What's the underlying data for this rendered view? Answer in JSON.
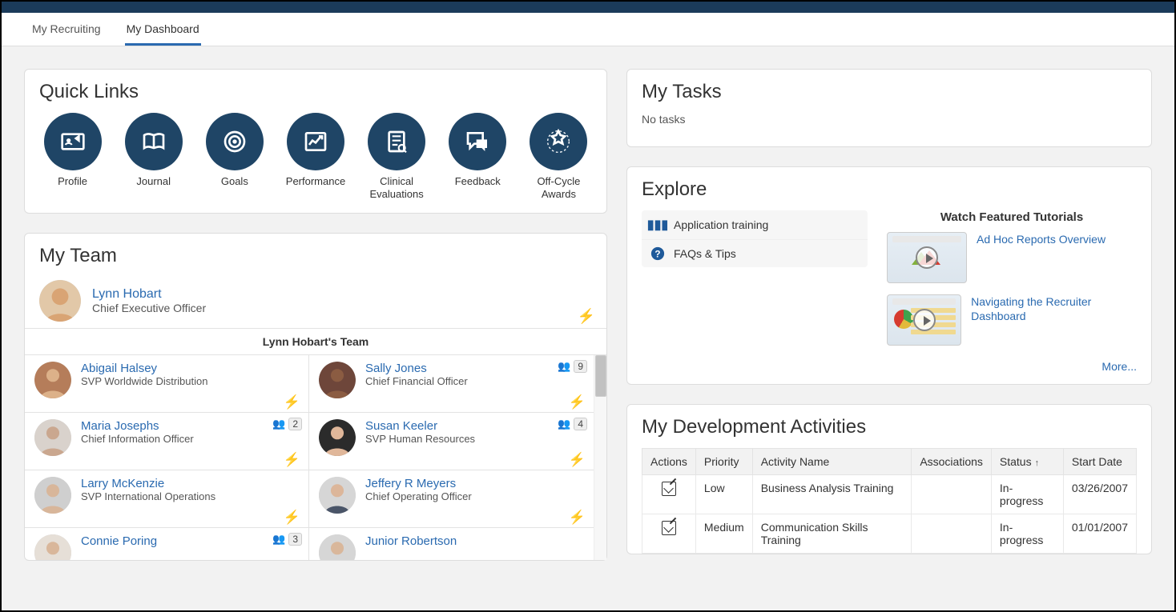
{
  "tabs": [
    {
      "label": "My Recruiting",
      "active": false
    },
    {
      "label": "My Dashboard",
      "active": true
    }
  ],
  "quickLinks": {
    "title": "Quick Links",
    "items": [
      {
        "label": "Profile"
      },
      {
        "label": "Journal"
      },
      {
        "label": "Goals"
      },
      {
        "label": "Performance"
      },
      {
        "label": "Clinical Evaluations"
      },
      {
        "label": "Feedback"
      },
      {
        "label": "Off-Cycle Awards"
      }
    ]
  },
  "myTeam": {
    "title": "My Team",
    "manager": {
      "name": "Lynn Hobart",
      "title": "Chief Executive Officer"
    },
    "teamLabel": "Lynn Hobart's Team",
    "members": [
      {
        "name": "Abigail Halsey",
        "title": "SVP Worldwide Distribution",
        "count": null
      },
      {
        "name": "Sally Jones",
        "title": "Chief Financial Officer",
        "count": "9"
      },
      {
        "name": "Maria Josephs",
        "title": "Chief Information Officer",
        "count": "2"
      },
      {
        "name": "Susan Keeler",
        "title": "SVP Human Resources",
        "count": "4"
      },
      {
        "name": "Larry McKenzie",
        "title": "SVP International Operations",
        "count": null
      },
      {
        "name": "Jeffery R Meyers",
        "title": "Chief Operating Officer",
        "count": null
      },
      {
        "name": "Connie Poring",
        "title": "",
        "count": "3"
      },
      {
        "name": "Junior Robertson",
        "title": "",
        "count": null
      }
    ]
  },
  "myTasks": {
    "title": "My Tasks",
    "empty": "No tasks"
  },
  "explore": {
    "title": "Explore",
    "items": [
      {
        "label": "Application training"
      },
      {
        "label": "FAQs & Tips"
      }
    ],
    "tutorialsHeader": "Watch Featured Tutorials",
    "tutorials": [
      {
        "label": "Ad Hoc Reports Overview"
      },
      {
        "label": "Navigating the Recruiter Dashboard"
      }
    ],
    "more": "More..."
  },
  "devActivities": {
    "title": "My Development Activities",
    "columns": {
      "actions": "Actions",
      "priority": "Priority",
      "activity": "Activity Name",
      "associations": "Associations",
      "status": "Status",
      "startDate": "Start Date"
    },
    "rows": [
      {
        "priority": "Low",
        "activity": "Business Analysis Training",
        "associations": "",
        "status": "In-progress",
        "startDate": "03/26/2007"
      },
      {
        "priority": "Medium",
        "activity": "Communication Skills Training",
        "associations": "",
        "status": "In-progress",
        "startDate": "01/01/2007"
      }
    ]
  }
}
